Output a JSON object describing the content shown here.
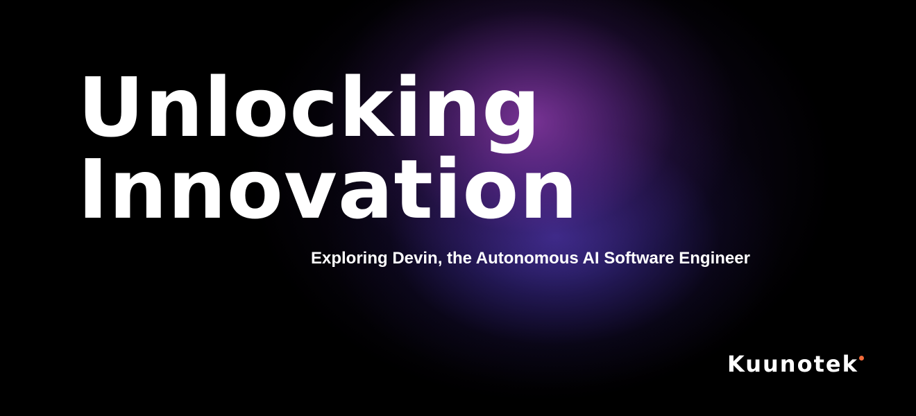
{
  "banner": {
    "title_line_1": "Unlocking",
    "title_line_2": "Innovation",
    "subtitle": "Exploring Devin, the Autonomous AI Software Engineer"
  },
  "logo": {
    "text": "Kuunotek",
    "accent_color": "#f26b3a"
  },
  "colors": {
    "background": "#000000",
    "glow_purple": "#8a3aa8",
    "glow_blue": "#4836aa",
    "text": "#ffffff"
  }
}
